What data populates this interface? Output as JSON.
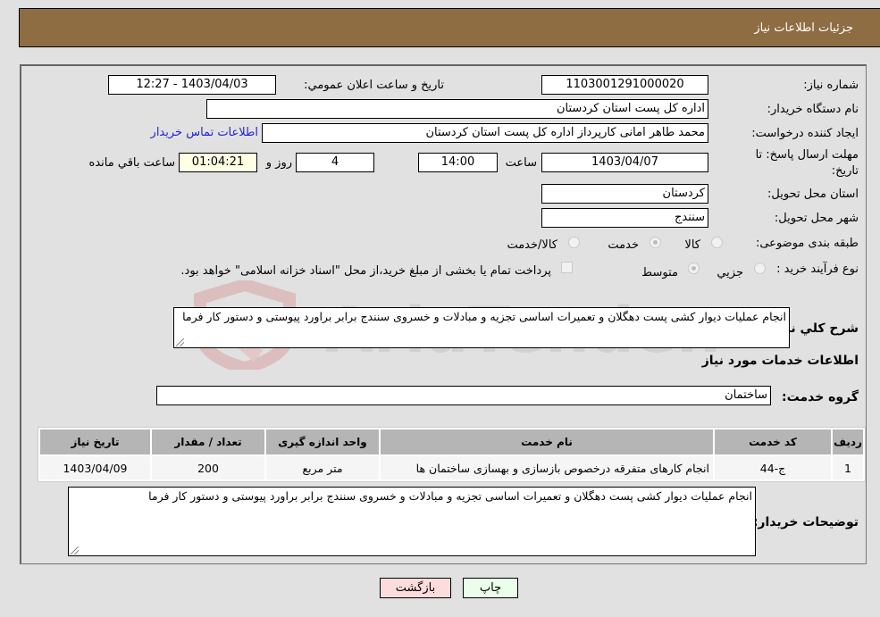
{
  "header": {
    "title": "جزئیات اطلاعات نیاز"
  },
  "form": {
    "need_number": {
      "label": "شماره نیاز:",
      "value": "1103001291000020"
    },
    "announce_datetime": {
      "label": "تاریخ و ساعت اعلان عمومي:",
      "value": "1403/04/03 - 12:27"
    },
    "buyer_org": {
      "label": "نام دستگاه خریدار:",
      "value": "اداره کل پست استان کردستان"
    },
    "requester": {
      "label": "ایجاد کننده درخواست:",
      "value": "محمد طاهر امانی کارپرداز اداره کل پست استان کردستان"
    },
    "buyer_contact_link": "اطلاعات تماس خریدار",
    "deadline": {
      "label_line1": "مهلت ارسال پاسخ: تا",
      "label_line2": "تاریخ:",
      "date": "1403/04/07",
      "time_label": "ساعت",
      "time": "14:00",
      "days": "4",
      "days_label": "روز و",
      "remaining": "01:04:21",
      "remaining_label": "ساعت باقي مانده"
    },
    "delivery_province": {
      "label": "استان محل تحویل:",
      "value": "کردستان"
    },
    "delivery_city": {
      "label": "شهر محل تحویل:",
      "value": "سنندج"
    },
    "category": {
      "label": "طبقه بندی موضوعی:",
      "options": [
        "کالا",
        "خدمت",
        "کالا/خدمت"
      ],
      "selected": "خدمت"
    },
    "purchase_type": {
      "label": "نوع فرآیند خرید :",
      "options": [
        "جزيي",
        "متوسط"
      ],
      "selected": "متوسط",
      "treasury_checkbox_label": "پرداخت تمام یا بخشی از مبلغ خرید،از محل \"اسناد خزانه اسلامی\" خواهد بود."
    },
    "general_description": {
      "label": "شرح کلي نیاز:",
      "value": "انجام عملیات دیوار کشی پست دهگلان و تعمیرات اساسی تجزیه و مبادلات و خسروی سنندج برابر براورد پیوستی و دستور کار فرما"
    },
    "services_section_title": "اطلاعات خدمات مورد نیاز",
    "service_group": {
      "label": "گروه خدمت:",
      "value": "ساختمان"
    }
  },
  "table": {
    "headers": [
      "ردیف",
      "کد خدمت",
      "نام خدمت",
      "واحد اندازه گیری",
      "تعداد / مقدار",
      "تاریخ نیاز"
    ],
    "rows": [
      [
        "1",
        "ج-44",
        "انجام کارهای متفرقه درخصوص بازسازی و بهسازی ساختمان ها",
        "متر مربع",
        "200",
        "1403/04/09"
      ]
    ]
  },
  "buyer_notes": {
    "label": "توضیحات خریدار:",
    "value": "انجام عملیات دیوار کشی پست دهگلان و تعمیرات اساسی تجزیه و مبادلات و خسروی سنندج برابر براورد پیوستی و دستور کار فرما"
  },
  "buttons": {
    "print": "چاپ",
    "back": "بازگشت"
  },
  "colors": {
    "header_bg": "#8e6d42",
    "link": "#2323d6",
    "print_bg": "#eaffea",
    "back_bg": "#ffdcdc"
  },
  "watermark": "AriaTender.neT"
}
